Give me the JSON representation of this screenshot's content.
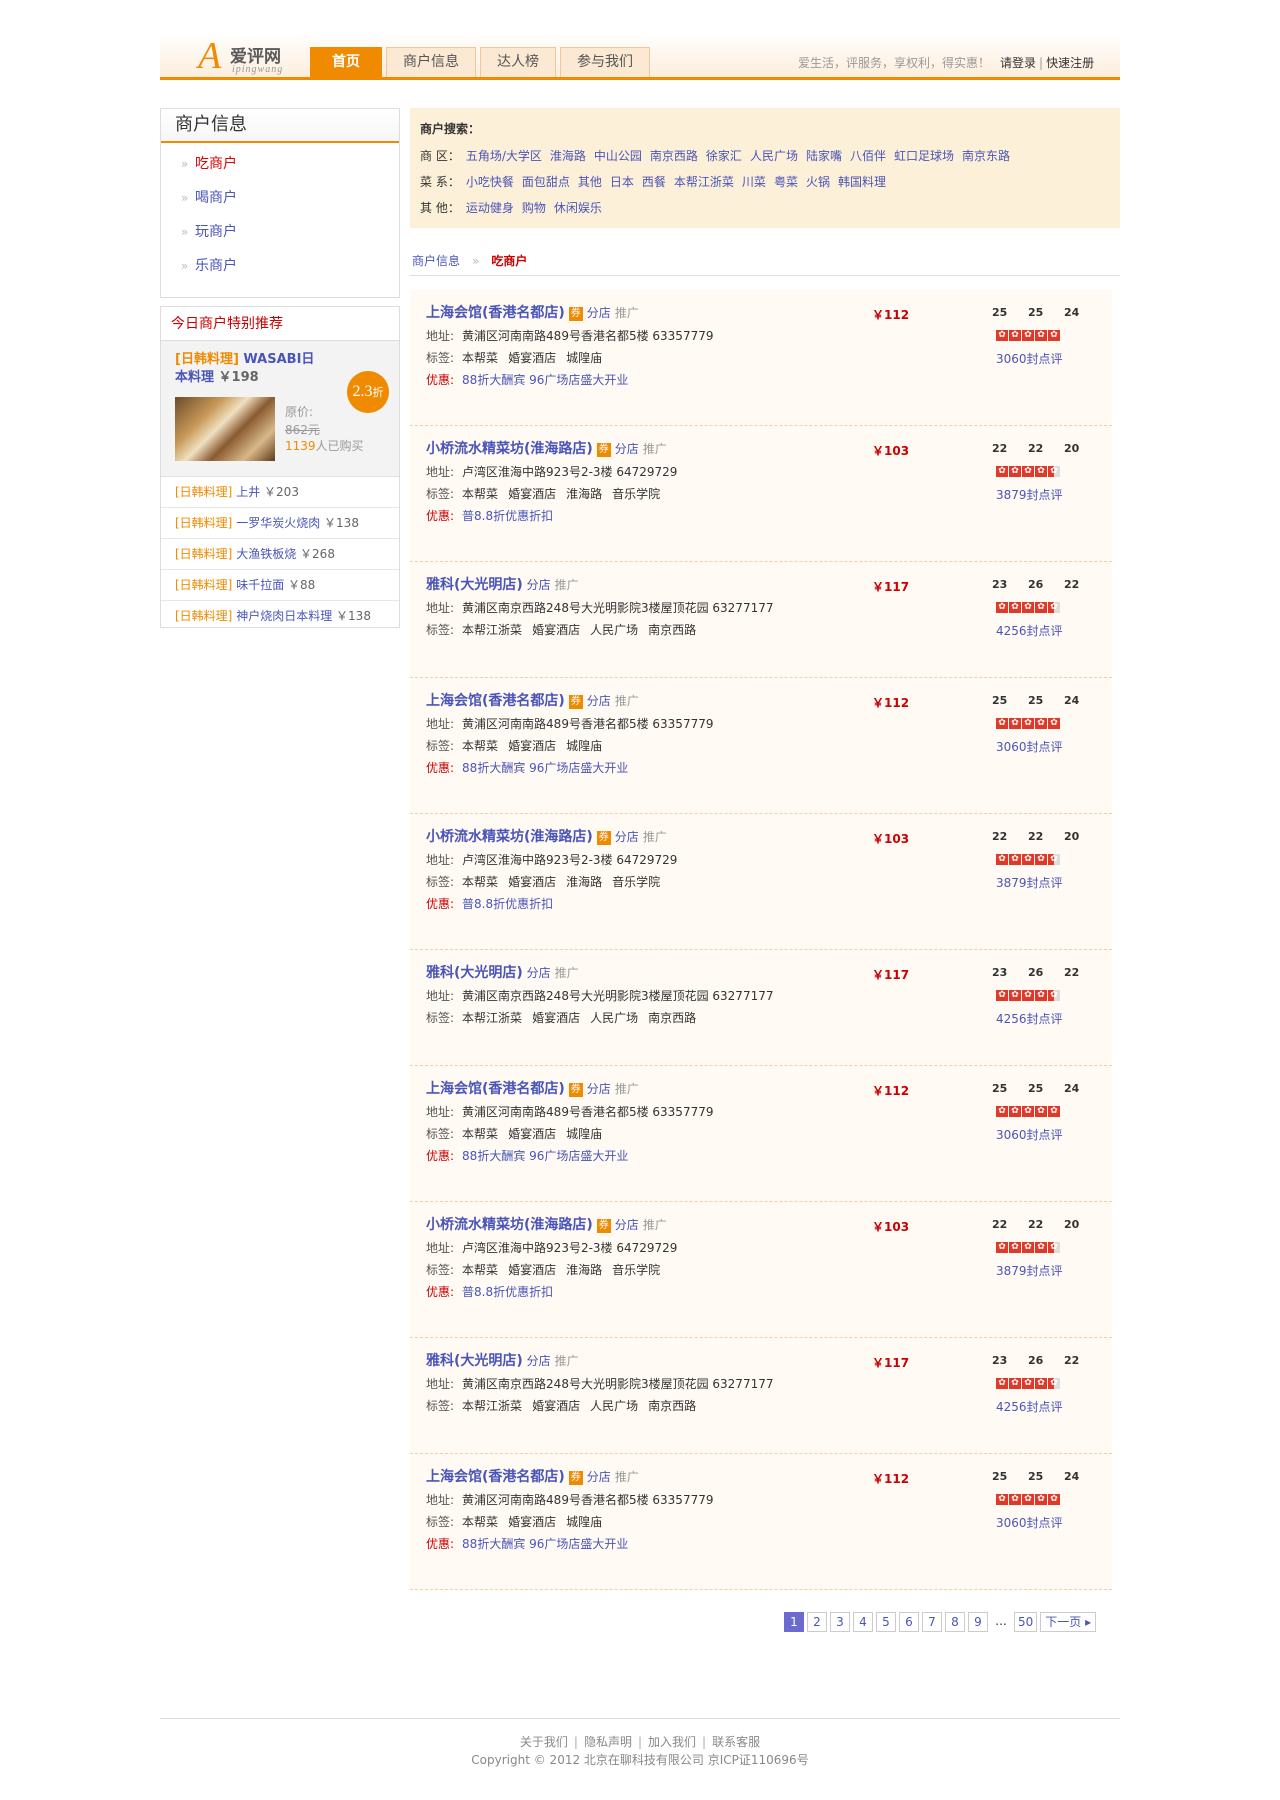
{
  "header": {
    "logo_letter": "A",
    "logo_cn": "爱评网",
    "logo_en": "ipingwang",
    "nav": [
      "首页",
      "商户信息",
      "达人榜",
      "参与我们"
    ],
    "slogan": "爱生活，评服务，享权利，得实惠！",
    "login": "请登录",
    "register": "快速注册"
  },
  "sidebar": {
    "title": "商户信息",
    "items": [
      "吃商户",
      "喝商户",
      "玩商户",
      "乐商户"
    ],
    "rec_title": "今日商户特别推荐",
    "featured": {
      "category": "[日韩料理]",
      "name": "WASABI日本料理",
      "price": "￥198",
      "orig_label": "原价:",
      "orig_price": "862元",
      "bought_count": "1139",
      "bought_suffix": "人已购买",
      "discount": "2.3",
      "discount_unit": "折"
    },
    "rec_list": [
      {
        "cat": "[日韩料理]",
        "name": "上井",
        "price": "￥203"
      },
      {
        "cat": "[日韩料理]",
        "name": "一罗华炭火烧肉",
        "price": "￥138"
      },
      {
        "cat": "[日韩料理]",
        "name": "大渔铁板烧",
        "price": "￥268"
      },
      {
        "cat": "[日韩料理]",
        "name": "味千拉面",
        "price": "￥88"
      },
      {
        "cat": "[日韩料理]",
        "name": "神户烧肉日本料理",
        "price": "￥138"
      }
    ]
  },
  "search": {
    "title": "商户搜索：",
    "district_label": "商  区：",
    "districts": [
      "五角场/大学区",
      "淮海路",
      "中山公园",
      "南京西路",
      "徐家汇",
      "人民广场",
      "陆家嘴",
      "八佰伴",
      "虹口足球场",
      "南京东路"
    ],
    "cuisine_label": "菜  系：",
    "cuisines": [
      "小吃快餐",
      "面包甜点",
      "其他",
      "日本",
      "西餐",
      "本帮江浙菜",
      "川菜",
      "粤菜",
      "火锅",
      "韩国料理"
    ],
    "other_label": "其  他：",
    "others": [
      "运动健身",
      "购物",
      "休闲娱乐"
    ]
  },
  "breadcrumb": {
    "root": "商户信息",
    "arrow": "»",
    "current": "吃商户"
  },
  "labels": {
    "address": "地址:",
    "tags": "标签:",
    "promo": "优惠:",
    "branch": "分店",
    "promote": "推广",
    "coupon": "券"
  },
  "listings": [
    {
      "name": "上海会馆(香港名都店)",
      "coupon": true,
      "price": "￥112",
      "s1": "25",
      "s2": "25",
      "s3": "24",
      "rating": 5,
      "address": "黄浦区河南南路489号香港名都5楼  63357779",
      "tags": [
        "本帮菜",
        "婚宴酒店",
        "城隍庙"
      ],
      "promo": "88折大酬宾 96广场店盛大开业",
      "reviews": "3060封点评"
    },
    {
      "name": "小桥流水精菜坊(淮海路店)",
      "coupon": true,
      "price": "￥103",
      "s1": "22",
      "s2": "22",
      "s3": "20",
      "rating": 4.5,
      "address": "卢湾区淮海中路923号2-3楼  64729729",
      "tags": [
        "本帮菜",
        "婚宴酒店",
        "淮海路",
        "音乐学院"
      ],
      "promo": "普8.8折优惠折扣",
      "reviews": "3879封点评"
    },
    {
      "name": "雅科(大光明店)",
      "coupon": false,
      "price": "￥117",
      "s1": "23",
      "s2": "26",
      "s3": "22",
      "rating": 4.5,
      "address": "黄浦区南京西路248号大光明影院3楼屋顶花园  63277177",
      "tags": [
        "本帮江浙菜",
        "婚宴酒店",
        "人民广场",
        "南京西路"
      ],
      "promo": "",
      "reviews": "4256封点评"
    },
    {
      "name": "上海会馆(香港名都店)",
      "coupon": true,
      "price": "￥112",
      "s1": "25",
      "s2": "25",
      "s3": "24",
      "rating": 5,
      "address": "黄浦区河南南路489号香港名都5楼  63357779",
      "tags": [
        "本帮菜",
        "婚宴酒店",
        "城隍庙"
      ],
      "promo": "88折大酬宾 96广场店盛大开业",
      "reviews": "3060封点评"
    },
    {
      "name": "小桥流水精菜坊(淮海路店)",
      "coupon": true,
      "price": "￥103",
      "s1": "22",
      "s2": "22",
      "s3": "20",
      "rating": 4.5,
      "address": "卢湾区淮海中路923号2-3楼  64729729",
      "tags": [
        "本帮菜",
        "婚宴酒店",
        "淮海路",
        "音乐学院"
      ],
      "promo": "普8.8折优惠折扣",
      "reviews": "3879封点评"
    },
    {
      "name": "雅科(大光明店)",
      "coupon": false,
      "price": "￥117",
      "s1": "23",
      "s2": "26",
      "s3": "22",
      "rating": 4.5,
      "address": "黄浦区南京西路248号大光明影院3楼屋顶花园  63277177",
      "tags": [
        "本帮江浙菜",
        "婚宴酒店",
        "人民广场",
        "南京西路"
      ],
      "promo": "",
      "reviews": "4256封点评"
    },
    {
      "name": "上海会馆(香港名都店)",
      "coupon": true,
      "price": "￥112",
      "s1": "25",
      "s2": "25",
      "s3": "24",
      "rating": 5,
      "address": "黄浦区河南南路489号香港名都5楼  63357779",
      "tags": [
        "本帮菜",
        "婚宴酒店",
        "城隍庙"
      ],
      "promo": "88折大酬宾 96广场店盛大开业",
      "reviews": "3060封点评"
    },
    {
      "name": "小桥流水精菜坊(淮海路店)",
      "coupon": true,
      "price": "￥103",
      "s1": "22",
      "s2": "22",
      "s3": "20",
      "rating": 4.5,
      "address": "卢湾区淮海中路923号2-3楼  64729729",
      "tags": [
        "本帮菜",
        "婚宴酒店",
        "淮海路",
        "音乐学院"
      ],
      "promo": "普8.8折优惠折扣",
      "reviews": "3879封点评"
    },
    {
      "name": "雅科(大光明店)",
      "coupon": false,
      "price": "￥117",
      "s1": "23",
      "s2": "26",
      "s3": "22",
      "rating": 4.5,
      "address": "黄浦区南京西路248号大光明影院3楼屋顶花园  63277177",
      "tags": [
        "本帮江浙菜",
        "婚宴酒店",
        "人民广场",
        "南京西路"
      ],
      "promo": "",
      "reviews": "4256封点评"
    },
    {
      "name": "上海会馆(香港名都店)",
      "coupon": true,
      "price": "￥112",
      "s1": "25",
      "s2": "25",
      "s3": "24",
      "rating": 5,
      "address": "黄浦区河南南路489号香港名都5楼  63357779",
      "tags": [
        "本帮菜",
        "婚宴酒店",
        "城隍庙"
      ],
      "promo": "88折大酬宾 96广场店盛大开业",
      "reviews": "3060封点评"
    }
  ],
  "pager": {
    "pages": [
      "1",
      "2",
      "3",
      "4",
      "5",
      "6",
      "7",
      "8",
      "9"
    ],
    "current": "1",
    "ellipsis": "...",
    "last": "50",
    "next": "下一页"
  },
  "footer": {
    "links": [
      "关于我们",
      "隐私声明",
      "加入我们",
      "联系客服"
    ],
    "copyright": "Copyright © 2012 北京在聊科技有限公司   京ICP证110696号"
  }
}
